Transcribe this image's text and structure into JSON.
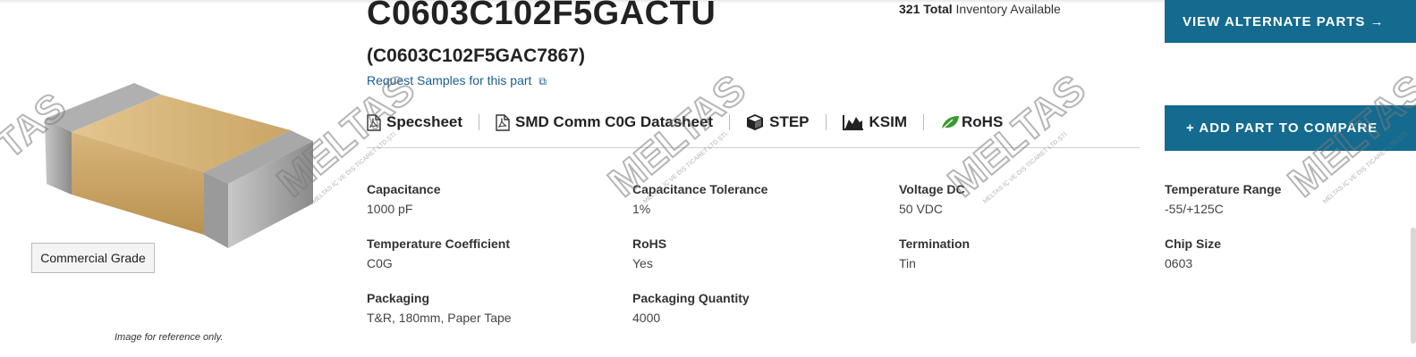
{
  "part": {
    "number": "C0603C102F5GACTU",
    "alt_number": "(C0603C102F5GAC7867)",
    "sample_link": "Request Samples for this part",
    "sample_link_icon": "external-link-icon"
  },
  "inventory": {
    "total": "321 Total",
    "label": "Inventory Available"
  },
  "image": {
    "grade_badge": "Commercial Grade",
    "note": "Image for reference only."
  },
  "docs": [
    {
      "label": "Specsheet",
      "icon": "pdf-icon"
    },
    {
      "label": "SMD Comm C0G Datasheet",
      "icon": "pdf-icon"
    },
    {
      "label": "STEP",
      "icon": "cube-icon"
    },
    {
      "label": "KSIM",
      "icon": "chart-icon"
    },
    {
      "label": "RoHS",
      "icon": "leaf-icon"
    }
  ],
  "buttons": {
    "alternate": "VIEW ALTERNATE PARTS →",
    "compare": "+ ADD PART TO COMPARE"
  },
  "specs": [
    {
      "label": "Capacitance",
      "value": "1000 pF"
    },
    {
      "label": "Capacitance Tolerance",
      "value": "1%"
    },
    {
      "label": "Voltage DC",
      "value": "50 VDC"
    },
    {
      "label": "Temperature Range",
      "value": "-55/+125C"
    },
    {
      "label": "Temperature Coefficient",
      "value": "C0G"
    },
    {
      "label": "RoHS",
      "value": "Yes"
    },
    {
      "label": "Termination",
      "value": "Tin"
    },
    {
      "label": "Chip Size",
      "value": "0603"
    },
    {
      "label": "Packaging",
      "value": "T&R, 180mm, Paper Tape"
    },
    {
      "label": "Packaging Quantity",
      "value": "4000"
    }
  ],
  "watermark": {
    "brand": "MELTAS",
    "subtext": "MELTAS İÇ VE DIŞ TİCARET LTD.ŞTİ."
  },
  "colors": {
    "button": "#146b8f",
    "link": "#1a5d8f",
    "rohs_leaf": "#3a9a2e"
  }
}
